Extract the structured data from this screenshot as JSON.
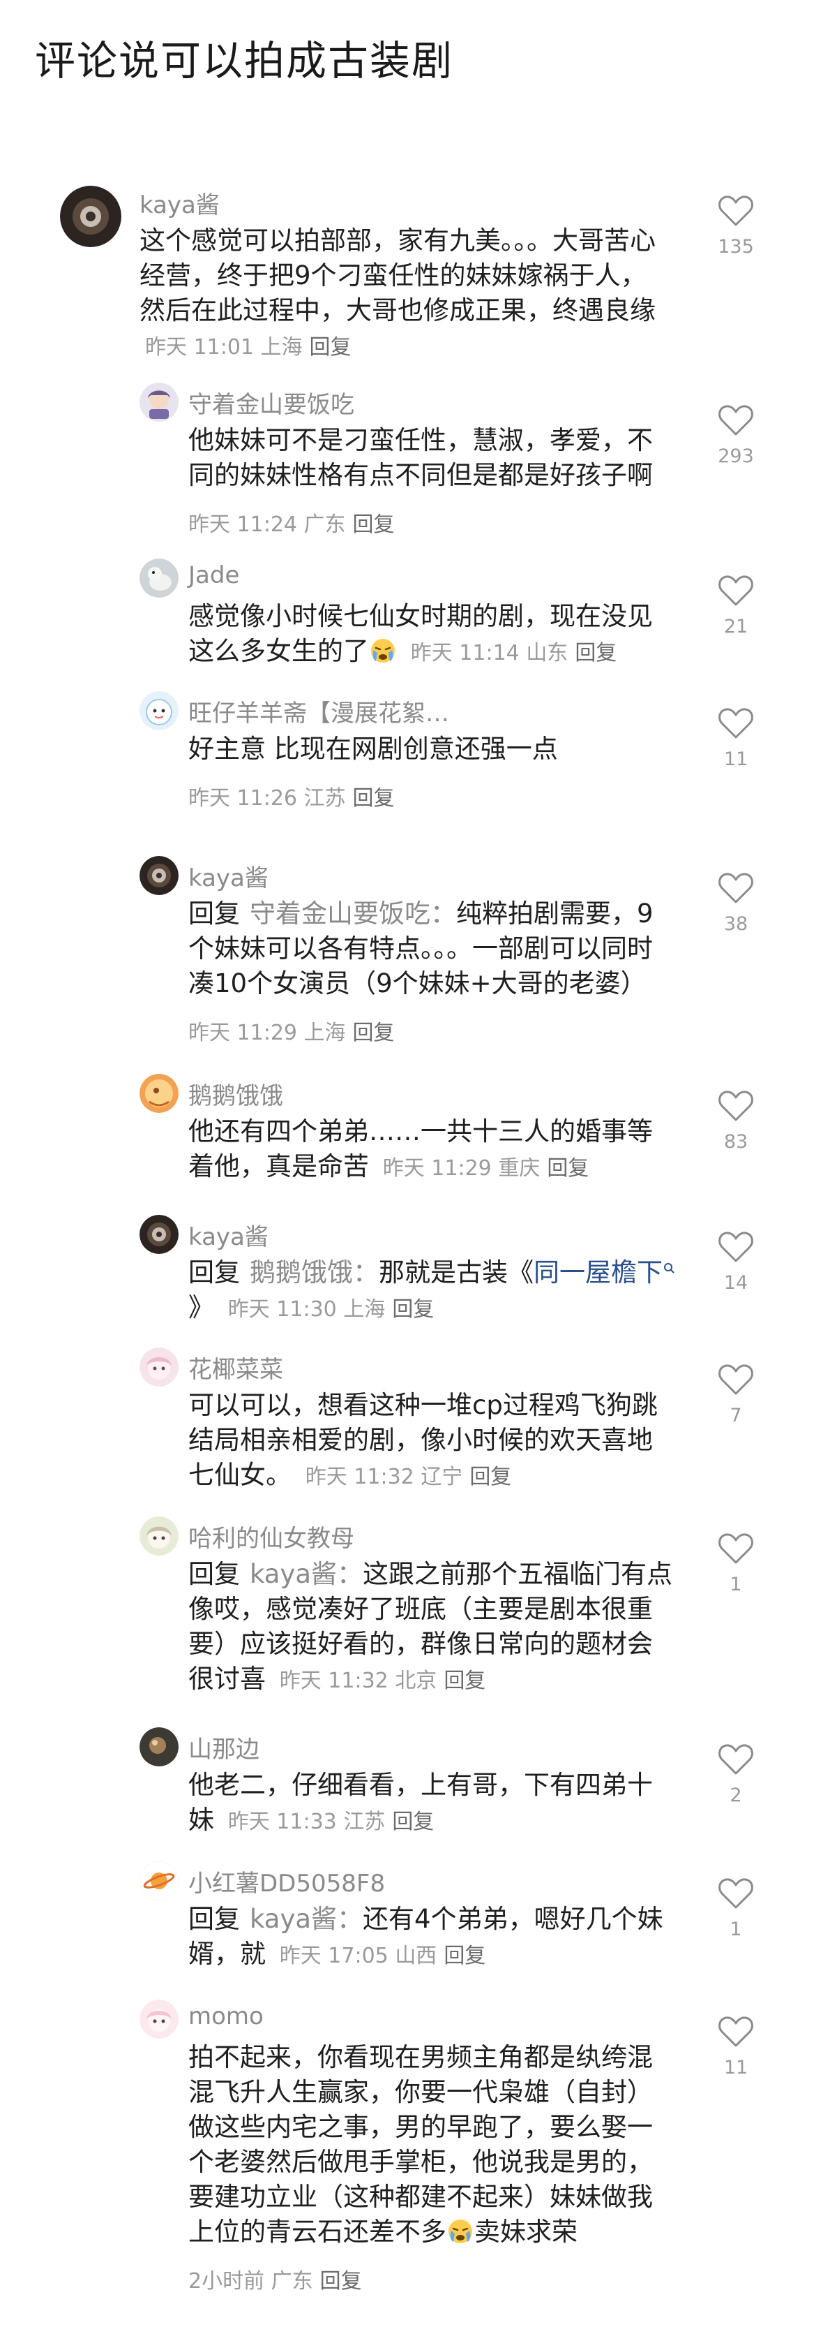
{
  "page": {
    "title": "评论说可以拍成古装剧"
  },
  "comments": [
    {
      "user": "kaya酱",
      "text": "这个感觉可以拍部部，家有九美。。。大哥苦心经营，终于把9个刁蛮任性的妹妹嫁祸于人，然后在此过程中，大哥也修成正果，终遇良缘",
      "time": "昨天 11:01",
      "location": "上海",
      "reply_label": "回复",
      "likes": "135"
    },
    {
      "user": "守着金山要饭吃",
      "text": "他妹妹可不是刁蛮任性，慧淑，孝爱，不同的妹妹性格有点不同但是都是好孩子啊",
      "time": "昨天 11:24",
      "location": "广东",
      "reply_label": "回复",
      "likes": "293"
    },
    {
      "user": "Jade",
      "text": "感觉像小时候七仙女时期的剧，现在没见这么多女生的了",
      "time": "昨天 11:14",
      "location": "山东",
      "reply_label": "回复",
      "likes": "21"
    },
    {
      "user": "旺仔羊羊斋【漫展花絮…",
      "text": "好主意 比现在网剧创意还强一点",
      "time": "昨天 11:26",
      "location": "江苏",
      "reply_label": "回复",
      "likes": "11"
    },
    {
      "user": "kaya酱",
      "reply_prefix": "回复",
      "reply_target": "守着金山要饭吃：",
      "text": "纯粹拍剧需要，9个妹妹可以各有特点。。。一部剧可以同时凑10个女演员（9个妹妹+大哥的老婆）",
      "time": "昨天 11:29",
      "location": "上海",
      "reply_label": "回复",
      "likes": "38"
    },
    {
      "user": "鹅鹅饿饿",
      "text": "他还有四个弟弟……一共十三人的婚事等着他，真是命苦",
      "time": "昨天 11:29",
      "location": "重庆",
      "reply_label": "回复",
      "likes": "83"
    },
    {
      "user": "kaya酱",
      "reply_prefix": "回复",
      "reply_target": "鹅鹅饿饿：",
      "text_before_link": "那就是古装《",
      "link_text": "同一屋檐下",
      "text_after_link": "》",
      "time": "昨天 11:30",
      "location": "上海",
      "reply_label": "回复",
      "likes": "14"
    },
    {
      "user": "花椰菜菜",
      "text": "可以可以，想看这种一堆cp过程鸡飞狗跳结局相亲相爱的剧，像小时候的欢天喜地七仙女。",
      "time": "昨天 11:32",
      "location": "辽宁",
      "reply_label": "回复",
      "likes": "7"
    },
    {
      "user": "哈利的仙女教母",
      "reply_prefix": "回复",
      "reply_target": "kaya酱：",
      "text": "这跟之前那个五福临门有点像哎，感觉凑好了班底（主要是剧本很重要）应该挺好看的，群像日常向的题材会很讨喜",
      "time": "昨天 11:32",
      "location": "北京",
      "reply_label": "回复",
      "likes": "1"
    },
    {
      "user": "山那边",
      "text": "他老二，仔细看看，上有哥，下有四弟十妹",
      "time": "昨天 11:33",
      "location": "江苏",
      "reply_label": "回复",
      "likes": "2"
    },
    {
      "user": "小红薯DD5058F8",
      "reply_prefix": "回复",
      "reply_target": "kaya酱：",
      "text": "还有4个弟弟，嗯好几个妹婿，就",
      "time": "昨天 17:05",
      "location": "山西",
      "reply_label": "回复",
      "likes": "1"
    },
    {
      "user": "momo",
      "text": "拍不起来，你看现在男频主角都是纨绔混混飞升人生赢家，你要一代枭雄（自封）做这些内宅之事，男的早跑了，要么娶一个老婆然后做甩手掌柜，他说我是男的，要建功立业（这种都建不起来）妹妹做我上位的青云石还差不多",
      "text_after_emoji": "卖妹求荣",
      "time": "2小时前",
      "location": "广东",
      "reply_label": "回复",
      "likes": "11"
    }
  ],
  "colors": {
    "username": "#8a8a8a",
    "meta": "#9a9a9a",
    "link": "#2a4f8a"
  },
  "icons": {
    "like": "heart-outline-icon",
    "emoji": "crying-face-icon"
  }
}
